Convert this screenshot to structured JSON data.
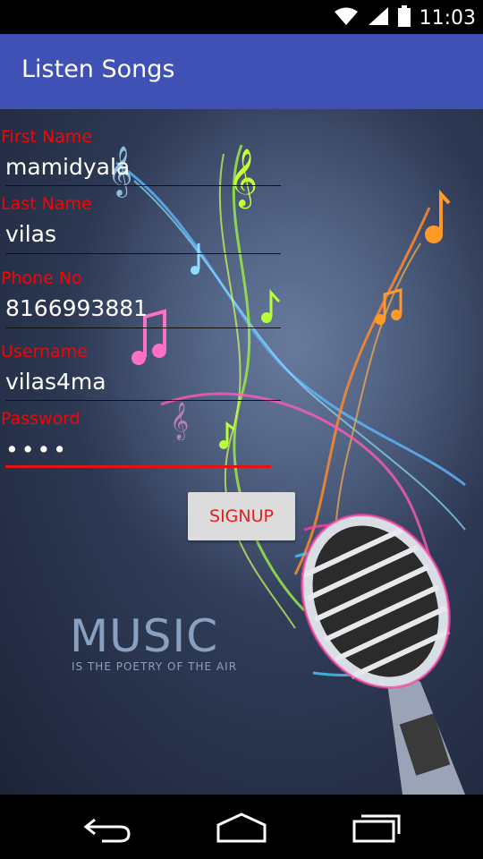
{
  "status_bar": {
    "time": "11:03"
  },
  "app_bar": {
    "title": "Listen Songs"
  },
  "form": {
    "first_name": {
      "label": "First Name",
      "value": "mamidyala"
    },
    "last_name": {
      "label": "Last Name",
      "value": "vilas"
    },
    "phone": {
      "label": "Phone No",
      "value": "8166993881"
    },
    "username": {
      "label": "Username",
      "value": "vilas4ma"
    },
    "password": {
      "label": "Password",
      "value": "••••"
    },
    "signup_label": "SIGNUP"
  },
  "background": {
    "headline": "MUSIC",
    "tagline": "IS THE POETRY OF THE AIR"
  },
  "colors": {
    "app_bar": "#3F51B5",
    "label_red": "#ff0000",
    "accent_line": "#e31313"
  }
}
